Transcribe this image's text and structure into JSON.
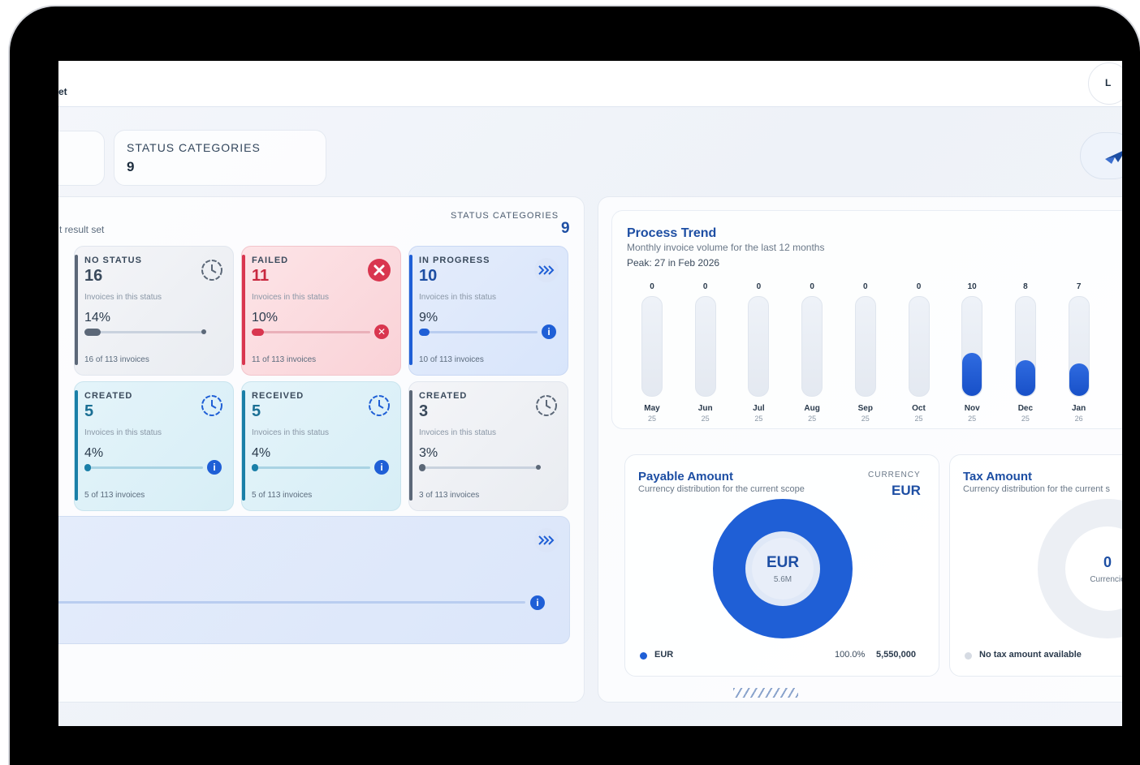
{
  "header": {
    "title": "et",
    "user_initial": "L"
  },
  "kpis": {
    "status_categories_label": "STATUS CATEGORIES",
    "status_categories_value": "9"
  },
  "status_panel": {
    "subtitle": "t result set",
    "categories_label": "STATUS CATEGORIES",
    "categories_value": "9",
    "tiles": [
      {
        "label": "NO STATUS",
        "count": "16",
        "sub": "Invoices in this status",
        "pct": "14%",
        "fraction": 0.14,
        "footer": "16 of 113 invoices",
        "icon": "clock-icon"
      },
      {
        "label": "FAILED",
        "count": "11",
        "sub": "Invoices in this status",
        "pct": "10%",
        "fraction": 0.1,
        "footer": "11 of 113 invoices",
        "icon": "error-icon"
      },
      {
        "label": "IN PROGRESS",
        "count": "10",
        "sub": "Invoices in this status",
        "pct": "9%",
        "fraction": 0.09,
        "footer": "10 of 113 invoices",
        "icon": "forward-icon"
      },
      {
        "label": "CREATED",
        "count": "5",
        "sub": "Invoices in this status",
        "pct": "4%",
        "fraction": 0.04,
        "footer": "5 of 113 invoices",
        "icon": "clock-icon"
      },
      {
        "label": "RECEIVED",
        "count": "5",
        "sub": "Invoices in this status",
        "pct": "4%",
        "fraction": 0.04,
        "footer": "5 of 113 invoices",
        "icon": "clock-icon"
      },
      {
        "label": "CREATED",
        "count": "3",
        "sub": "Invoices in this status",
        "pct": "3%",
        "fraction": 0.03,
        "footer": "3 of 113 invoices",
        "icon": "clock-icon"
      }
    ]
  },
  "trend": {
    "title": "Process Trend",
    "subtitle": "Monthly invoice volume for the last 12 months",
    "peak": "Peak: 27 in Feb 2026",
    "max": 27
  },
  "chart_data": {
    "type": "bar",
    "categories": [
      "May 25",
      "Jun 25",
      "Jul 25",
      "Aug 25",
      "Sep 25",
      "Oct 25",
      "Nov 25",
      "Dec 25",
      "Jan 26"
    ],
    "values": [
      0,
      0,
      0,
      0,
      0,
      0,
      10,
      8,
      7
    ],
    "month_names": [
      "May",
      "Jun",
      "Jul",
      "Aug",
      "Sep",
      "Oct",
      "Nov",
      "Dec",
      "Jan"
    ],
    "years": [
      "25",
      "25",
      "25",
      "25",
      "25",
      "25",
      "25",
      "25",
      "26"
    ],
    "title": "Process Trend"
  },
  "payable": {
    "title": "Payable Amount",
    "subtitle": "Currency distribution for the current scope",
    "currency_label": "CURRENCY",
    "currency_value": "EUR",
    "center_label": "EUR",
    "center_sub": "5.6M",
    "legend": [
      {
        "name": "EUR",
        "pct": "100.0%",
        "amount": "5,550,000",
        "color": "#1f5fd6"
      }
    ]
  },
  "tax": {
    "title": "Tax Amount",
    "subtitle": "Currency distribution for the current s",
    "center_value": "0",
    "center_sub": "Currencie",
    "empty_text": "No tax amount available"
  },
  "colors": {
    "accent": "#1d4ea3",
    "failed": "#d9364f",
    "progress": "#1f5fd6",
    "neutral": "#5c6878",
    "cyan": "#1a8bb5"
  }
}
